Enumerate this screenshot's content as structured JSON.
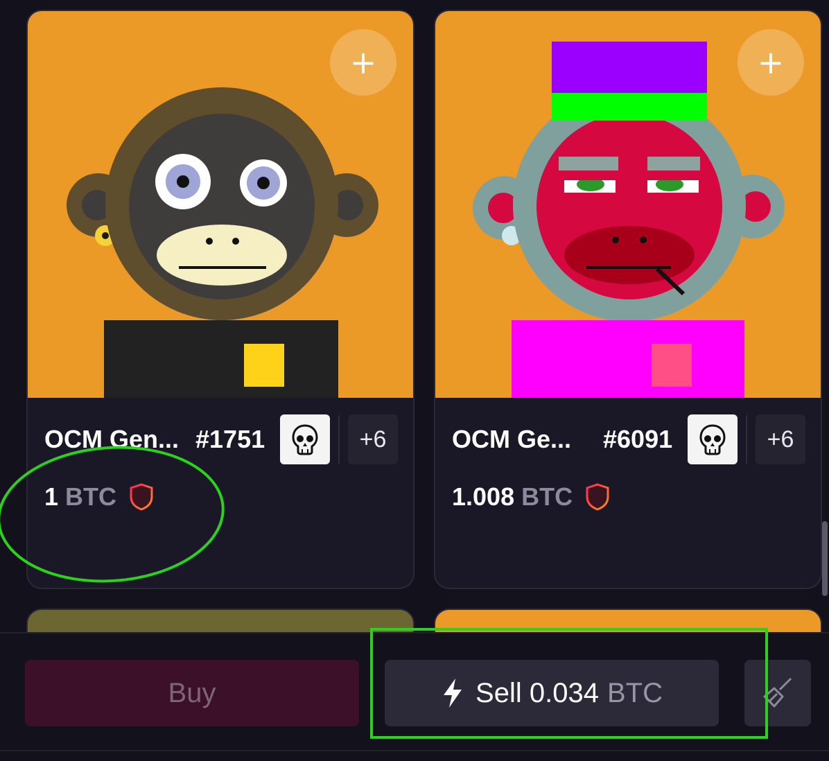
{
  "colors": {
    "background": "#13111c",
    "card_bg": "#1a1826",
    "art_bg": "#ec9a27",
    "buy_bg": "#3c1028",
    "sell_bg": "#2c2a38",
    "highlight": "#2bd11c"
  },
  "cards": [
    {
      "name": "OCM Gen...",
      "number": "#1751",
      "price": "1",
      "currency": "BTC",
      "more": "+6",
      "plus": "+",
      "icons": [
        "plus-icon",
        "skull-icon",
        "shield-icon"
      ]
    },
    {
      "name": "OCM Ge...",
      "number": "#6091",
      "price": "1.008",
      "currency": "BTC",
      "more": "+6",
      "plus": "+",
      "icons": [
        "plus-icon",
        "skull-icon",
        "shield-icon"
      ]
    }
  ],
  "actions": {
    "buy_label": "Buy",
    "sell_label": "Sell 0.034",
    "sell_unit": "BTC",
    "sell_icon": "lightning-icon",
    "sweep_icon": "broom-icon"
  }
}
